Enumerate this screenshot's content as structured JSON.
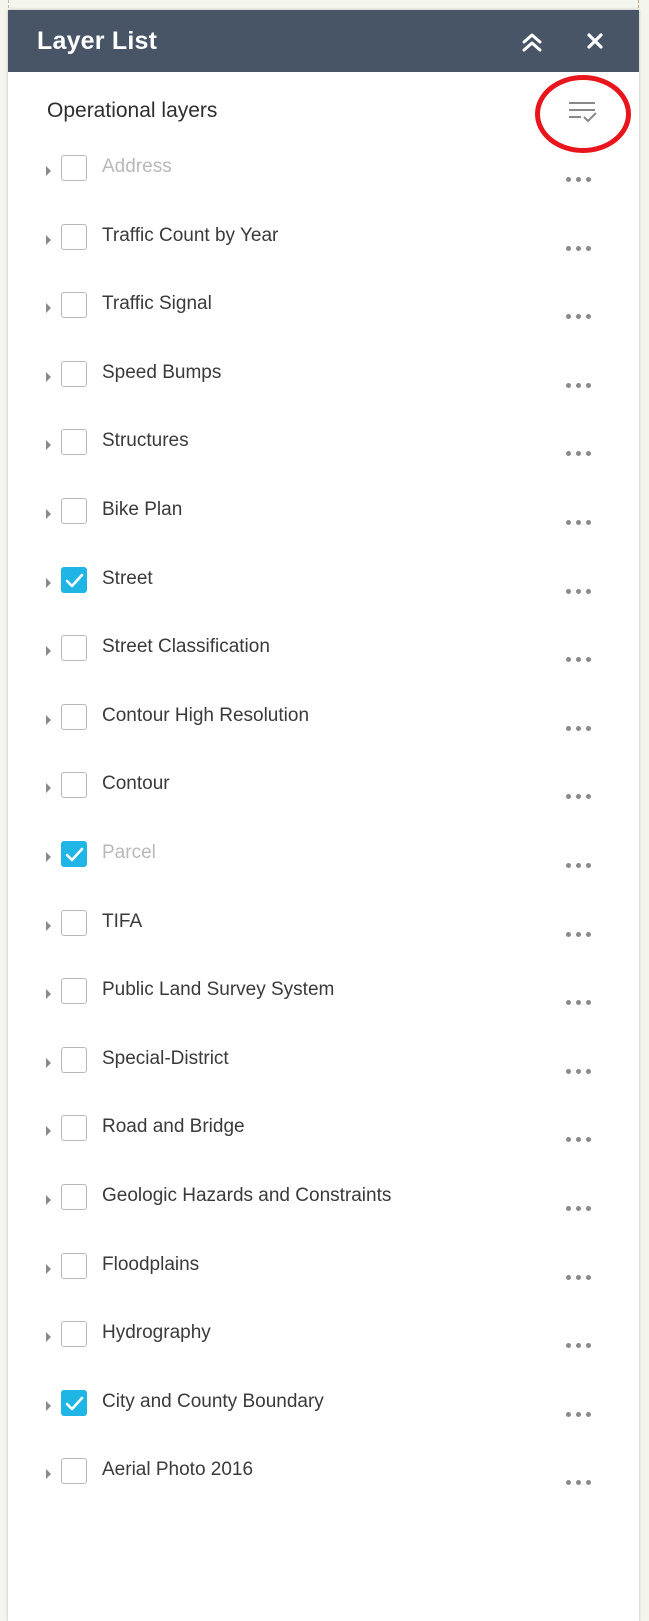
{
  "panel": {
    "title": "Layer List",
    "collapse_icon": "double-chevron-up-icon",
    "close_icon": "close-icon",
    "header_color": "#485566"
  },
  "section": {
    "title": "Operational layers",
    "options_icon": "list-options-icon",
    "highlight_color": "#e8151d"
  },
  "colors": {
    "checked": "#1fb5e5",
    "dimmed_text": "#b9b9b9"
  },
  "layers": [
    {
      "label": "Address",
      "checked": false,
      "dimmed": true
    },
    {
      "label": "Traffic Count by Year",
      "checked": false,
      "dimmed": false
    },
    {
      "label": "Traffic Signal",
      "checked": false,
      "dimmed": false
    },
    {
      "label": "Speed Bumps",
      "checked": false,
      "dimmed": false
    },
    {
      "label": "Structures",
      "checked": false,
      "dimmed": false
    },
    {
      "label": "Bike Plan",
      "checked": false,
      "dimmed": false
    },
    {
      "label": "Street",
      "checked": true,
      "dimmed": false
    },
    {
      "label": "Street Classification",
      "checked": false,
      "dimmed": false
    },
    {
      "label": "Contour High Resolution",
      "checked": false,
      "dimmed": false
    },
    {
      "label": "Contour",
      "checked": false,
      "dimmed": false
    },
    {
      "label": "Parcel",
      "checked": true,
      "dimmed": true
    },
    {
      "label": "TIFA",
      "checked": false,
      "dimmed": false
    },
    {
      "label": "Public Land Survey System",
      "checked": false,
      "dimmed": false
    },
    {
      "label": "Special-District",
      "checked": false,
      "dimmed": false
    },
    {
      "label": "Road and Bridge",
      "checked": false,
      "dimmed": false
    },
    {
      "label": "Geologic Hazards and Constraints",
      "checked": false,
      "dimmed": false
    },
    {
      "label": "Floodplains",
      "checked": false,
      "dimmed": false
    },
    {
      "label": "Hydrography",
      "checked": false,
      "dimmed": false
    },
    {
      "label": "City and County Boundary",
      "checked": true,
      "dimmed": false
    },
    {
      "label": "Aerial Photo 2016",
      "checked": false,
      "dimmed": false
    }
  ]
}
